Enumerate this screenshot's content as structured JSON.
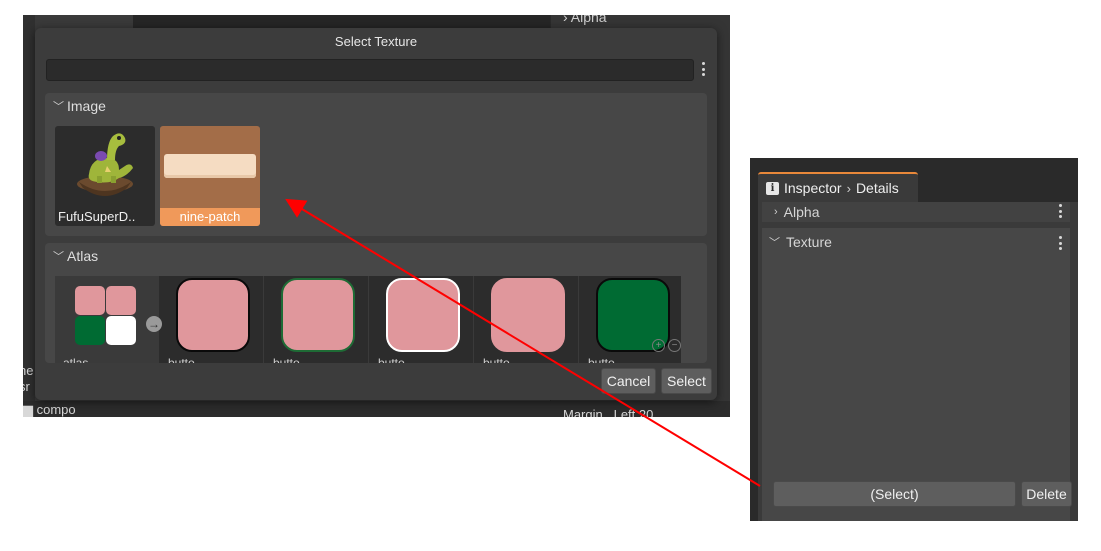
{
  "background_app": {
    "alpha_label": "Alpha",
    "left_misc": [
      "ne",
      "sr"
    ],
    "compo_label": "compo",
    "margin_label": "Margin",
    "left_label": "Left",
    "left_value": "20"
  },
  "dialog": {
    "title": "Select Texture",
    "search": {
      "value": "",
      "placeholder": ""
    },
    "image_section": {
      "header": "Image",
      "items": [
        {
          "label": "FufuSuperD..",
          "selected": false
        },
        {
          "label": "nine-patch",
          "selected": true
        }
      ]
    },
    "atlas_section": {
      "header": "Atlas",
      "items": [
        {
          "label": "atlas"
        },
        {
          "label": "butto",
          "color": "#e0979c",
          "border": "#0a0a0a"
        },
        {
          "label": "butto",
          "color": "#e0979c",
          "border": "#1e6b35"
        },
        {
          "label": "butto",
          "color": "#e0979c",
          "border": "#ffffff"
        },
        {
          "label": "butto",
          "color": "#e0979c",
          "border": "#e0979c"
        },
        {
          "label": "butto",
          "color": "#006b33",
          "border": "#0a0a0a"
        }
      ],
      "zoom_in_glyph": "+",
      "zoom_out_glyph": "−"
    },
    "buttons": {
      "cancel": "Cancel",
      "select": "Select"
    }
  },
  "inspector": {
    "tab": {
      "title": "Inspector",
      "separator": "›",
      "subtitle": "Details"
    },
    "alpha_row": "Alpha",
    "texture_header": "Texture",
    "select_button": "(Select)",
    "delete_button": "Delete"
  },
  "colors": {
    "accent_orange": "#f0995a",
    "annotation_arrow": "#ff0000"
  }
}
